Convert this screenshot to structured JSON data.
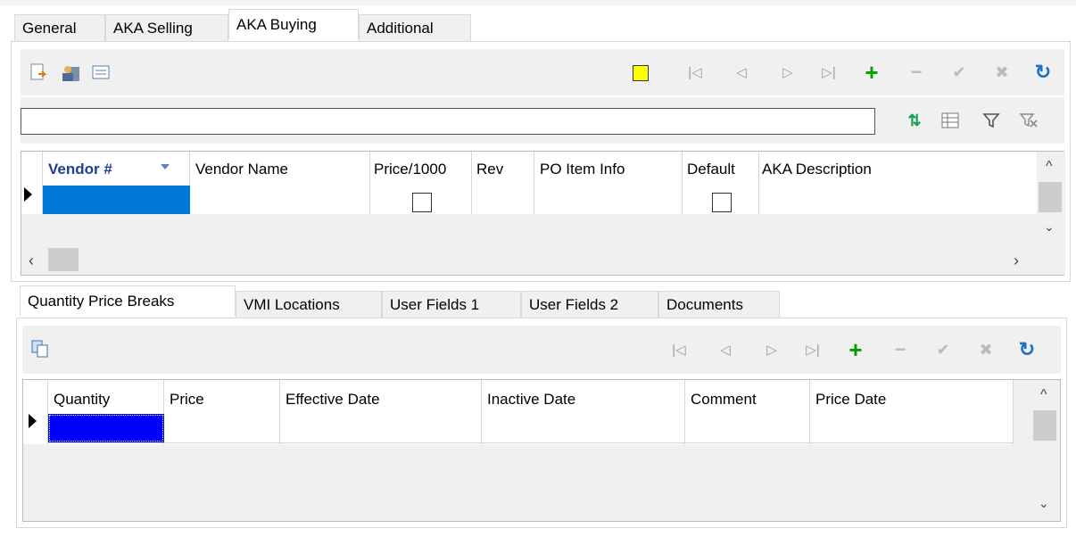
{
  "tabs": [
    "General",
    "AKA Selling",
    "AKA Buying",
    "Additional"
  ],
  "vendor_grid": {
    "columns": [
      "Vendor #",
      "Vendor Name",
      "Price/1000",
      "Rev",
      "PO Item Info",
      "Default",
      "AKA Description"
    ]
  },
  "search": {
    "value": "",
    "placeholder": ""
  },
  "sub_tabs": [
    "Quantity Price Breaks",
    "VMI Locations",
    "User Fields 1",
    "User Fields 2",
    "Documents"
  ],
  "price_grid": {
    "columns": [
      "Quantity",
      "Price",
      "Effective Date",
      "Inactive Date",
      "Comment",
      "Price Date"
    ]
  },
  "icons": {
    "top_toolbar": [
      "new-record-icon",
      "user-building-icon",
      "form-view-icon",
      "yellow-square-icon",
      "first-icon",
      "prev-icon",
      "next-icon",
      "last-icon",
      "add-icon",
      "delete-icon",
      "post-icon",
      "cancel-icon",
      "refresh-icon"
    ],
    "search_toolbar": [
      "sort-icon",
      "columns-icon",
      "filter-icon",
      "clear-filter-icon"
    ]
  },
  "colors": {
    "selection": "#0078d7",
    "selection_dark": "#0000ff",
    "add": "#00a000",
    "refresh": "#1e6fc8",
    "highlight": "#ffff00"
  }
}
